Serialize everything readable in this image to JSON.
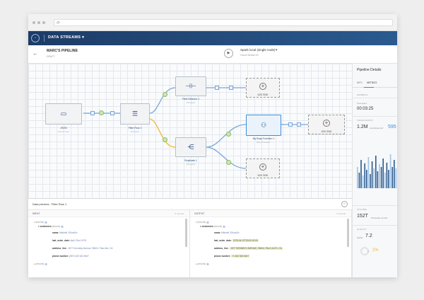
{
  "app": {
    "title": "DATA STREAMS",
    "title_caret": "▾"
  },
  "pipeline": {
    "name": "MARC'S PIPELINE",
    "version": "DRAFT"
  },
  "engine": {
    "label": "Spark local (single node)",
    "sub": "Cloud Stream ID",
    "caret": "▾"
  },
  "nodes": {
    "source": {
      "label": "JSON",
      "sub": "Source Type"
    },
    "filter": {
      "label": "Filter Row 1",
      "sub": "Processor"
    },
    "field_selector": {
      "label": "Field Selector 1",
      "sub": "Processor"
    },
    "replicate": {
      "label": "Replicate 1",
      "sub": "Processor"
    },
    "function": {
      "label": "My Busy Function 1",
      "sub": "Busy Processor"
    },
    "sink_label": "ADD SINK"
  },
  "right_panel": {
    "title": "Pipeline Details",
    "tabs": [
      "INFO",
      "METRICS"
    ],
    "general": "GENERAL",
    "time_label": "Time spent",
    "time_value": "00:03:25",
    "throughput_label": "THROUGHPUT",
    "throughput_value": "1.2M",
    "throughput_unit": "records/second",
    "throughput_peak": "595",
    "volume_label": "VOLUME",
    "volume_value": "152T",
    "volume_unit": "Processed records",
    "quality_label": "QUALITY",
    "quality_global": "Global",
    "quality_value": "7.2",
    "quality_pct": "2%"
  },
  "bottom_panel": {
    "title": "Data preview - Filter Row 1",
    "close": "−",
    "input": {
      "title": "INPUT",
      "count": "5 records",
      "record_label": "(record)",
      "customers_label": "customers",
      "customers_badge": "(record)",
      "rows": [
        {
          "key": "name:",
          "value": "Mitchell JOhnoDn"
        },
        {
          "key": "last_order_date:",
          "value": "April 22nd 1978"
        },
        {
          "key": "address_line :",
          "value": "1577 Kennedy Avenue, 95404, Palo Alto, CA"
        },
        {
          "key": "phone number:",
          "value": "(857) 452 543 8447"
        }
      ]
    },
    "output": {
      "title": "OUTPUT",
      "count": "5 records",
      "record_label": "(record)",
      "customers_label": "customers",
      "customers_badge": "(record)",
      "rows": [
        {
          "key": "name:",
          "value": "Mitchell JOhnoDn"
        },
        {
          "key": "last_order_date:",
          "value": "1978-04-22T00:00:00.00"
        },
        {
          "key": "address_line :",
          "value": "1577 KENNEDY AVENUE, 95404, PALO ALTO, CA"
        },
        {
          "key": "phone number:",
          "value": "+1 452 543 8447"
        }
      ]
    }
  }
}
